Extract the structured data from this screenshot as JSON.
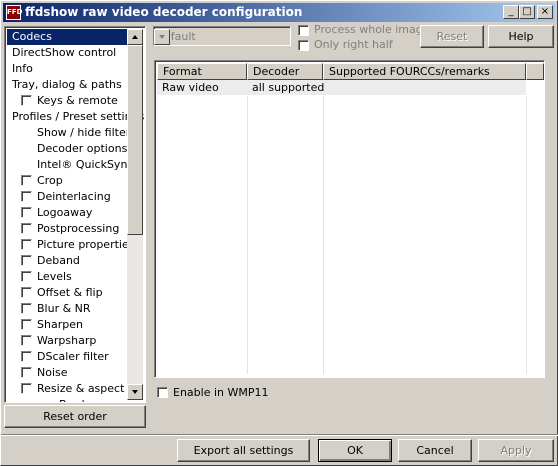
{
  "window": {
    "title": "ffdshow raw video decoder configuration",
    "app_icon_text": "FFD"
  },
  "sidebar": {
    "items": [
      {
        "label": "Codecs",
        "checkbox": false,
        "selected": true
      },
      {
        "label": "DirectShow control",
        "checkbox": false
      },
      {
        "label": "Info",
        "checkbox": false
      },
      {
        "label": "Tray, dialog & paths",
        "checkbox": false
      },
      {
        "label": "Keys & remote",
        "checkbox": true
      },
      {
        "label": "Profiles / Preset settings",
        "checkbox": false
      },
      {
        "label": "Show / hide filters",
        "checkbox": false
      },
      {
        "label": "Decoder options",
        "checkbox": false
      },
      {
        "label": "Intel® QuickSync",
        "checkbox": false
      },
      {
        "label": "Crop",
        "checkbox": true
      },
      {
        "label": "Deinterlacing",
        "checkbox": true
      },
      {
        "label": "Logoaway",
        "checkbox": true
      },
      {
        "label": "Postprocessing",
        "checkbox": true
      },
      {
        "label": "Picture properties",
        "checkbox": true
      },
      {
        "label": "Deband",
        "checkbox": true
      },
      {
        "label": "Levels",
        "checkbox": true
      },
      {
        "label": "Offset & flip",
        "checkbox": true
      },
      {
        "label": "Blur & NR",
        "checkbox": true
      },
      {
        "label": "Sharpen",
        "checkbox": true
      },
      {
        "label": "Warpsharp",
        "checkbox": true
      },
      {
        "label": "DScaler filter",
        "checkbox": true
      },
      {
        "label": "Noise",
        "checkbox": true
      },
      {
        "label": "Resize & aspect",
        "checkbox": true
      },
      {
        "label": "Borders",
        "checkbox": false
      }
    ],
    "reset_order_label": "Reset order"
  },
  "toolbar": {
    "preset_value": "default",
    "process_whole_image_label": "Process whole image",
    "only_right_half_label": "Only right half",
    "reset_label": "Reset",
    "help_label": "Help"
  },
  "codecs_table": {
    "columns": [
      "Format",
      "Decoder",
      "Supported FOURCCs/remarks"
    ],
    "rows": [
      {
        "format": "Raw video",
        "decoder": "all supported",
        "remarks": ""
      }
    ]
  },
  "enable_wmp11_label": "Enable in WMP11",
  "footer": {
    "export_label": "Export all settings",
    "ok_label": "OK",
    "cancel_label": "Cancel",
    "apply_label": "Apply"
  },
  "colors": {
    "title_gradient_start": "#0a246a",
    "title_gradient_end": "#a6caf0",
    "selection": "#0a246a",
    "face": "#d4d0c8"
  }
}
